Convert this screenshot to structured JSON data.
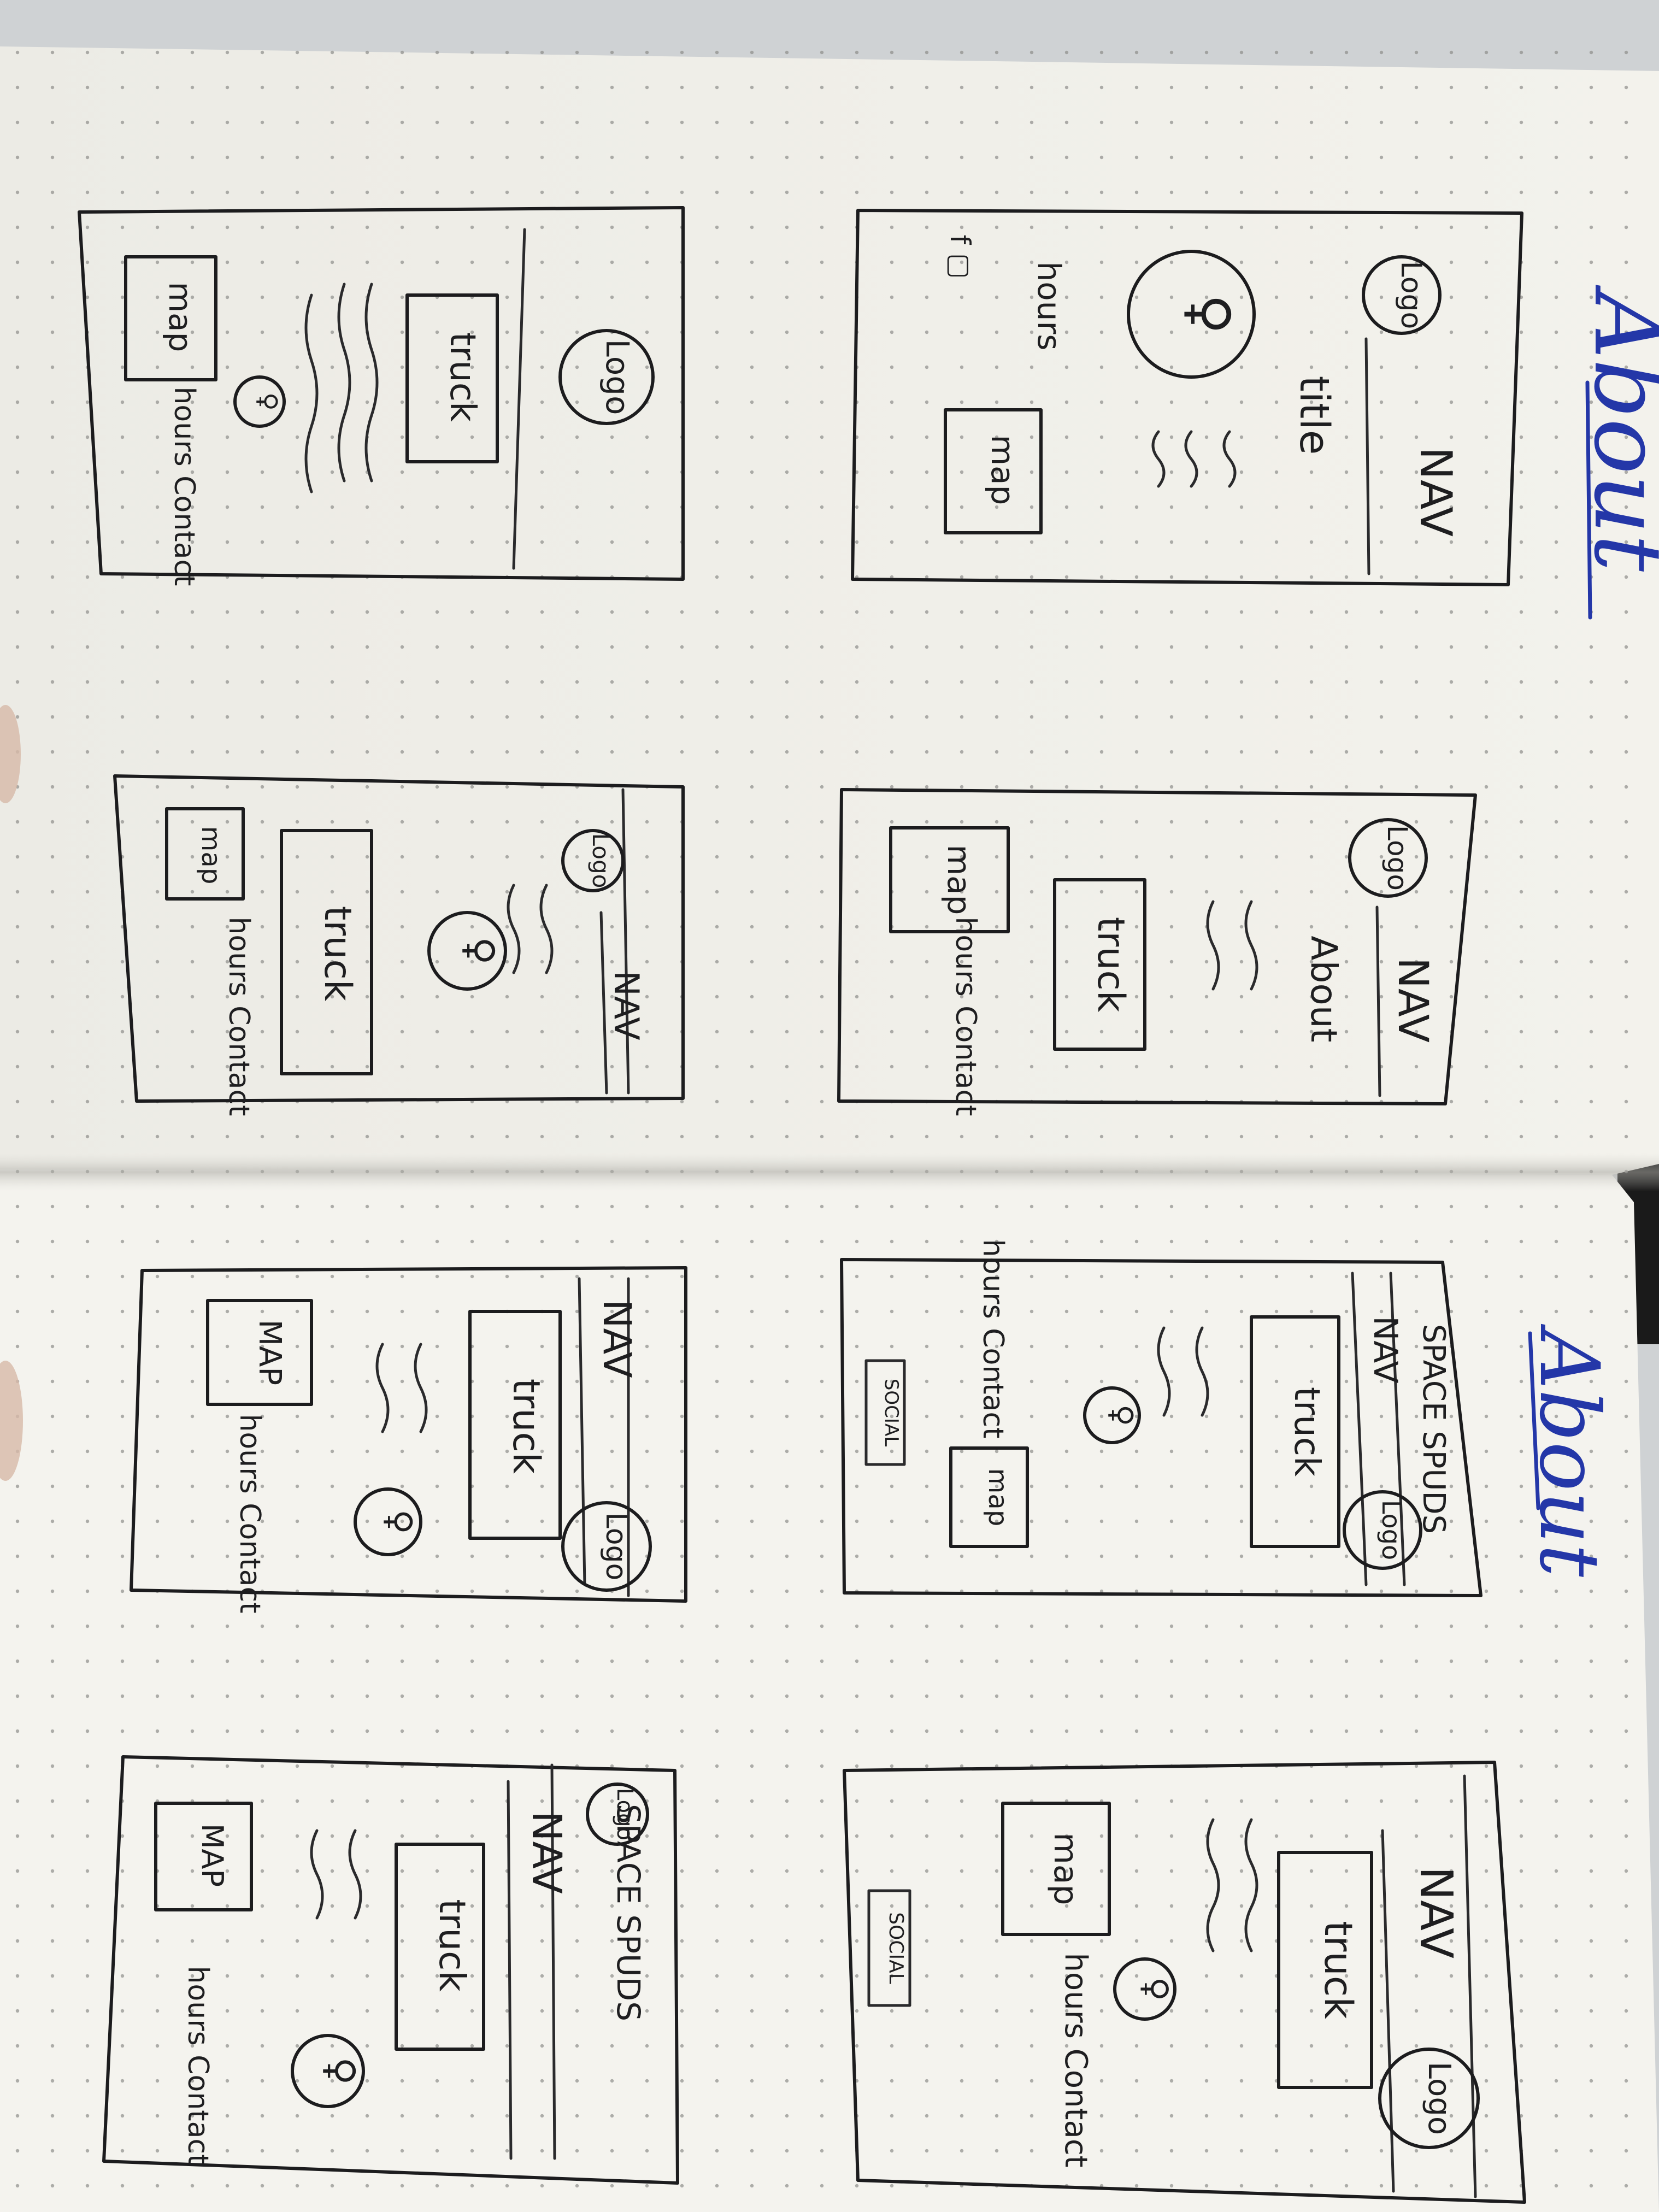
{
  "headings": {
    "top_page": "About",
    "bottom_page": "About"
  },
  "sketches": {
    "top_left": {
      "logo": "Logo",
      "button": "truck",
      "map": "map",
      "footer": "hours Contact"
    },
    "top_right": {
      "logo": "Logo",
      "nav": "NAV",
      "title": "title",
      "map": "map",
      "footer": "hours"
    },
    "mid_left": {
      "logo": "Logo",
      "nav": "NAV",
      "button": "truck",
      "map": "map",
      "footer": "hours Contact"
    },
    "mid_right": {
      "logo": "Logo",
      "nav": "NAV",
      "subtitle": "About",
      "button": "truck",
      "map": "map",
      "footer": "hours Contact"
    },
    "lower_left": {
      "logo": "Logo",
      "nav": "NAV",
      "button": "truck",
      "map": "MAP",
      "footer": "hours Contact"
    },
    "lower_right": {
      "brand": "SPACE SPUDS",
      "nav": "NAV",
      "logo": "Logo",
      "button": "truck",
      "map": "map",
      "footer": "hours Contact",
      "social": "SOCIAL"
    },
    "bottom_left": {
      "logo": "Logo",
      "brand": "SPACE SPUDS",
      "nav": "NAV",
      "button": "truck",
      "map": "MAP",
      "footer": "hours Contact"
    },
    "bottom_right": {
      "nav": "NAV",
      "logo": "Logo",
      "button": "truck",
      "map": "map",
      "footer": "hours Contact",
      "social": "SOCIAL"
    }
  }
}
